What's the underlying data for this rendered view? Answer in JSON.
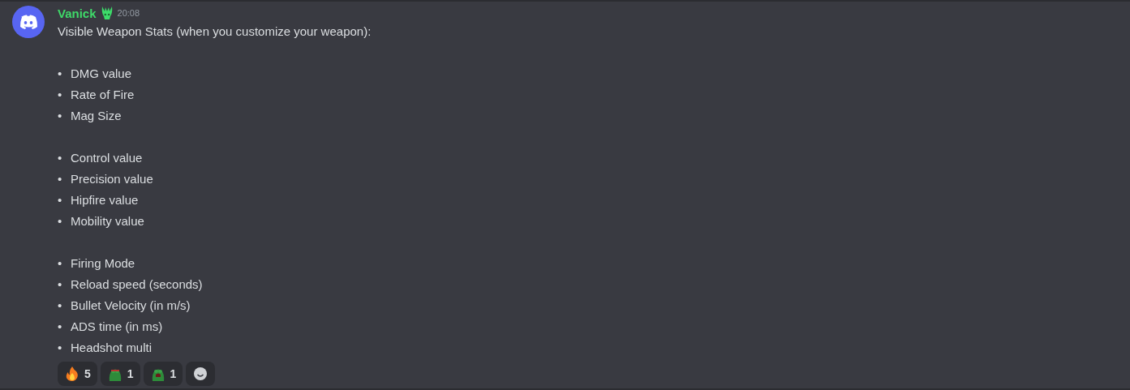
{
  "message": {
    "author": "Vanick",
    "time": "20:08",
    "text": "Visible Weapon Stats (when you customize your weapon):",
    "groups": [
      [
        {
          "marker": "•",
          "text": "DMG value"
        },
        {
          "marker": "•",
          "text": "Rate of Fire"
        },
        {
          "marker": "•",
          "text": "Mag Size"
        }
      ],
      [
        {
          "marker": "•",
          "text": "Control value"
        },
        {
          "marker": "•",
          "text": "Precision value"
        },
        {
          "marker": "•",
          "text": "Hipfire value"
        },
        {
          "marker": "•",
          "text": "Mobility value"
        }
      ],
      [
        {
          "marker": "•",
          "text": "Firing Mode"
        },
        {
          "marker": "•",
          "text": "Reload speed (seconds)"
        },
        {
          "marker": "•",
          "text": "Bullet Velocity (in m/s)"
        },
        {
          "marker": "•",
          "text": "ADS time (in ms)"
        },
        {
          "marker": "•",
          "text": "Headshot multi"
        }
      ]
    ],
    "reactions": [
      {
        "kind": "fire",
        "count": "5"
      },
      {
        "kind": "frog",
        "count": "1"
      },
      {
        "kind": "frog-angry",
        "count": "1"
      }
    ]
  }
}
